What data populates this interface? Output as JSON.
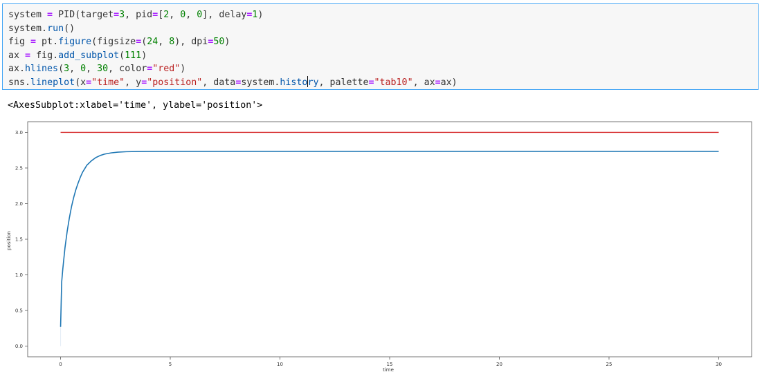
{
  "code_cell": {
    "lines": [
      [
        {
          "t": "system ",
          "c": "plain"
        },
        {
          "t": "=",
          "c": "kw-op"
        },
        {
          "t": " PID(target",
          "c": "plain"
        },
        {
          "t": "=",
          "c": "kw-op"
        },
        {
          "t": "3",
          "c": "num"
        },
        {
          "t": ", pid",
          "c": "plain"
        },
        {
          "t": "=",
          "c": "kw-op"
        },
        {
          "t": "[",
          "c": "plain"
        },
        {
          "t": "2",
          "c": "num"
        },
        {
          "t": ", ",
          "c": "plain"
        },
        {
          "t": "0",
          "c": "num"
        },
        {
          "t": ", ",
          "c": "plain"
        },
        {
          "t": "0",
          "c": "num"
        },
        {
          "t": "], delay",
          "c": "plain"
        },
        {
          "t": "=",
          "c": "kw-op"
        },
        {
          "t": "1",
          "c": "num"
        },
        {
          "t": ")",
          "c": "plain"
        }
      ],
      [
        {
          "t": "system",
          "c": "plain"
        },
        {
          "t": ".",
          "c": "plain"
        },
        {
          "t": "run",
          "c": "meth"
        },
        {
          "t": "()",
          "c": "plain"
        }
      ],
      [
        {
          "t": "fig ",
          "c": "plain"
        },
        {
          "t": "=",
          "c": "kw-op"
        },
        {
          "t": " pt",
          "c": "plain"
        },
        {
          "t": ".",
          "c": "plain"
        },
        {
          "t": "figure",
          "c": "meth"
        },
        {
          "t": "(figsize",
          "c": "plain"
        },
        {
          "t": "=",
          "c": "kw-op"
        },
        {
          "t": "(",
          "c": "plain"
        },
        {
          "t": "24",
          "c": "num"
        },
        {
          "t": ", ",
          "c": "plain"
        },
        {
          "t": "8",
          "c": "num"
        },
        {
          "t": "), dpi",
          "c": "plain"
        },
        {
          "t": "=",
          "c": "kw-op"
        },
        {
          "t": "50",
          "c": "num"
        },
        {
          "t": ")",
          "c": "plain"
        }
      ],
      [
        {
          "t": "ax ",
          "c": "plain"
        },
        {
          "t": "=",
          "c": "kw-op"
        },
        {
          "t": " fig",
          "c": "plain"
        },
        {
          "t": ".",
          "c": "plain"
        },
        {
          "t": "add_subplot",
          "c": "meth"
        },
        {
          "t": "(",
          "c": "plain"
        },
        {
          "t": "111",
          "c": "num"
        },
        {
          "t": ")",
          "c": "plain"
        }
      ],
      [
        {
          "t": "ax",
          "c": "plain"
        },
        {
          "t": ".",
          "c": "plain"
        },
        {
          "t": "hlines",
          "c": "meth"
        },
        {
          "t": "(",
          "c": "plain"
        },
        {
          "t": "3",
          "c": "num"
        },
        {
          "t": ", ",
          "c": "plain"
        },
        {
          "t": "0",
          "c": "num"
        },
        {
          "t": ", ",
          "c": "plain"
        },
        {
          "t": "30",
          "c": "num"
        },
        {
          "t": ", color",
          "c": "plain"
        },
        {
          "t": "=",
          "c": "kw-op"
        },
        {
          "t": "\"red\"",
          "c": "str"
        },
        {
          "t": ")",
          "c": "plain"
        }
      ],
      [
        {
          "t": "sns",
          "c": "plain"
        },
        {
          "t": ".",
          "c": "plain"
        },
        {
          "t": "lineplot",
          "c": "meth"
        },
        {
          "t": "(x",
          "c": "plain"
        },
        {
          "t": "=",
          "c": "kw-op"
        },
        {
          "t": "\"time\"",
          "c": "str"
        },
        {
          "t": ", y",
          "c": "plain"
        },
        {
          "t": "=",
          "c": "kw-op"
        },
        {
          "t": "\"position\"",
          "c": "str"
        },
        {
          "t": ", data",
          "c": "plain"
        },
        {
          "t": "=",
          "c": "kw-op"
        },
        {
          "t": "system",
          "c": "plain"
        },
        {
          "t": ".",
          "c": "plain"
        },
        {
          "t": "histo",
          "c": "meth"
        },
        {
          "t": "CURSOR",
          "c": "cursor"
        },
        {
          "t": "ry",
          "c": "meth"
        },
        {
          "t": ", palette",
          "c": "plain"
        },
        {
          "t": "=",
          "c": "kw-op"
        },
        {
          "t": "\"tab10\"",
          "c": "str"
        },
        {
          "t": ", ax",
          "c": "plain"
        },
        {
          "t": "=",
          "c": "kw-op"
        },
        {
          "t": "ax)",
          "c": "plain"
        }
      ]
    ]
  },
  "output": {
    "text": "<AxesSubplot:xlabel='time', ylabel='position'>"
  },
  "colors": {
    "cell_border": "#42a5f5",
    "cell_bg": "#f7f7f7",
    "target_line": "#d62728",
    "series_line": "#1f77b4"
  },
  "chart_data": {
    "type": "line",
    "xlabel": "time",
    "ylabel": "position",
    "xlim": [
      -1.5,
      31.5
    ],
    "ylim": [
      -0.15,
      3.15
    ],
    "xticks": [
      0,
      5,
      10,
      15,
      20,
      25,
      30
    ],
    "yticks": [
      0.0,
      0.5,
      1.0,
      1.5,
      2.0,
      2.5,
      3.0
    ],
    "xtick_labels": [
      "0",
      "5",
      "10",
      "15",
      "20",
      "25",
      "30"
    ],
    "ytick_labels": [
      "0.0",
      "0.5",
      "1.0",
      "1.5",
      "2.0",
      "2.5",
      "3.0"
    ],
    "grid": false,
    "hlines": [
      {
        "y": 3.0,
        "xmin": 0,
        "xmax": 30,
        "color": "red"
      }
    ],
    "series": [
      {
        "x": [
          0.0,
          0.05,
          0.1,
          0.2,
          0.3,
          0.4,
          0.5,
          0.6,
          0.7,
          0.8,
          0.9,
          1.0,
          1.2,
          1.4,
          1.6,
          1.8,
          2.0,
          2.3,
          2.6,
          3.0,
          3.5,
          4.0,
          5.0,
          6.0,
          8.0,
          10.0,
          15.0,
          20.0,
          25.0,
          30.0
        ],
        "y": [
          0.27,
          0.9,
          1.08,
          1.38,
          1.61,
          1.8,
          1.96,
          2.09,
          2.2,
          2.29,
          2.37,
          2.44,
          2.54,
          2.6,
          2.645,
          2.675,
          2.695,
          2.712,
          2.722,
          2.729,
          2.732,
          2.733,
          2.734,
          2.734,
          2.734,
          2.734,
          2.734,
          2.734,
          2.734,
          2.734
        ]
      }
    ]
  }
}
